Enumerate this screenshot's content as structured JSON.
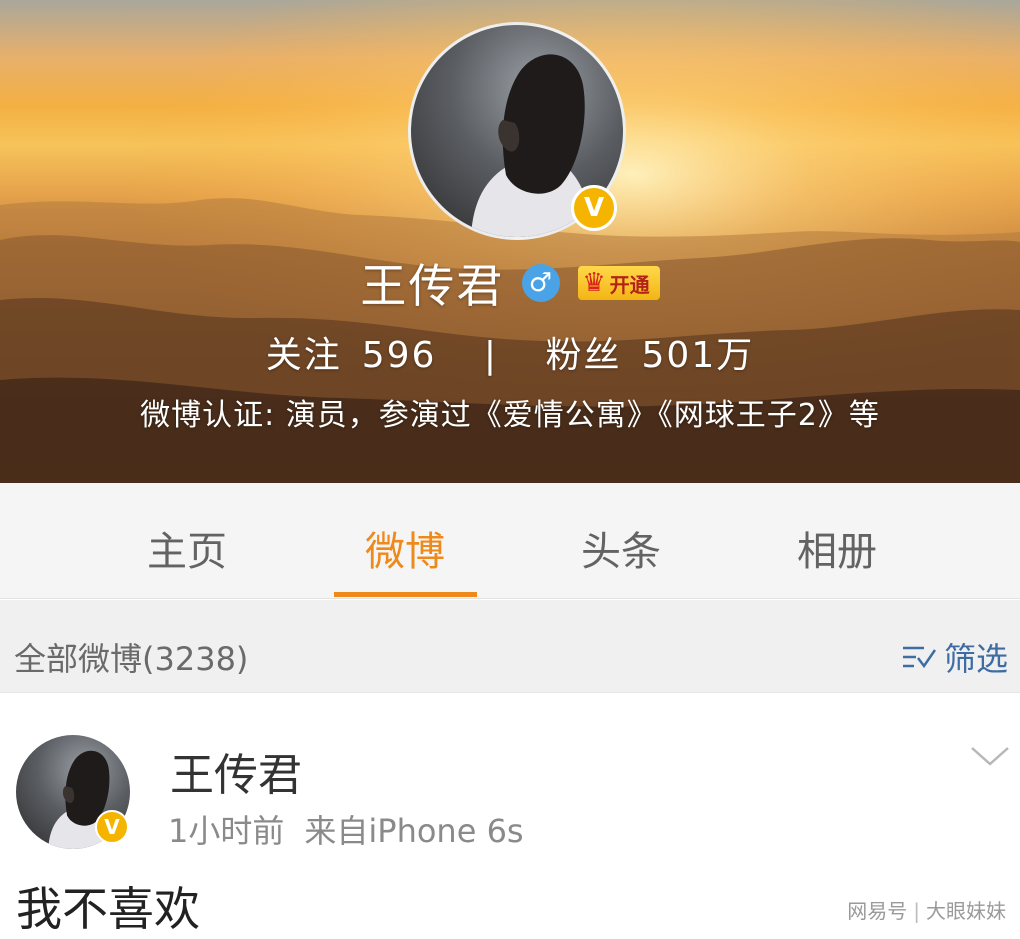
{
  "profile": {
    "name": "王传君",
    "gender_icon": "male-icon",
    "gender_glyph": "♂",
    "vip_label": "开通",
    "verify_glyph": "V",
    "stats": {
      "following_label": "关注",
      "following_count": "596",
      "separator": "|",
      "followers_label": "粉丝",
      "followers_count": "501万"
    },
    "certification": "微博认证: 演员，参演过《爱情公寓》《网球王子2》等"
  },
  "tabs": [
    {
      "label": "主页",
      "active": false
    },
    {
      "label": "微博",
      "active": true
    },
    {
      "label": "头条",
      "active": false
    },
    {
      "label": "相册",
      "active": false
    }
  ],
  "filter": {
    "all_posts_label": "全部微博(3238)",
    "filter_label": "筛选"
  },
  "post": {
    "author": "王传君",
    "time": "1小时前",
    "source": "来自iPhone 6s",
    "text": "我不喜欢"
  },
  "watermark": {
    "left": "网易号",
    "right": "大眼妹妹"
  },
  "colors": {
    "accent": "#ee8a1b",
    "link_blue": "#3f6da3",
    "verify_gold": "#f4b400",
    "gender_blue": "#4aa3e6"
  }
}
